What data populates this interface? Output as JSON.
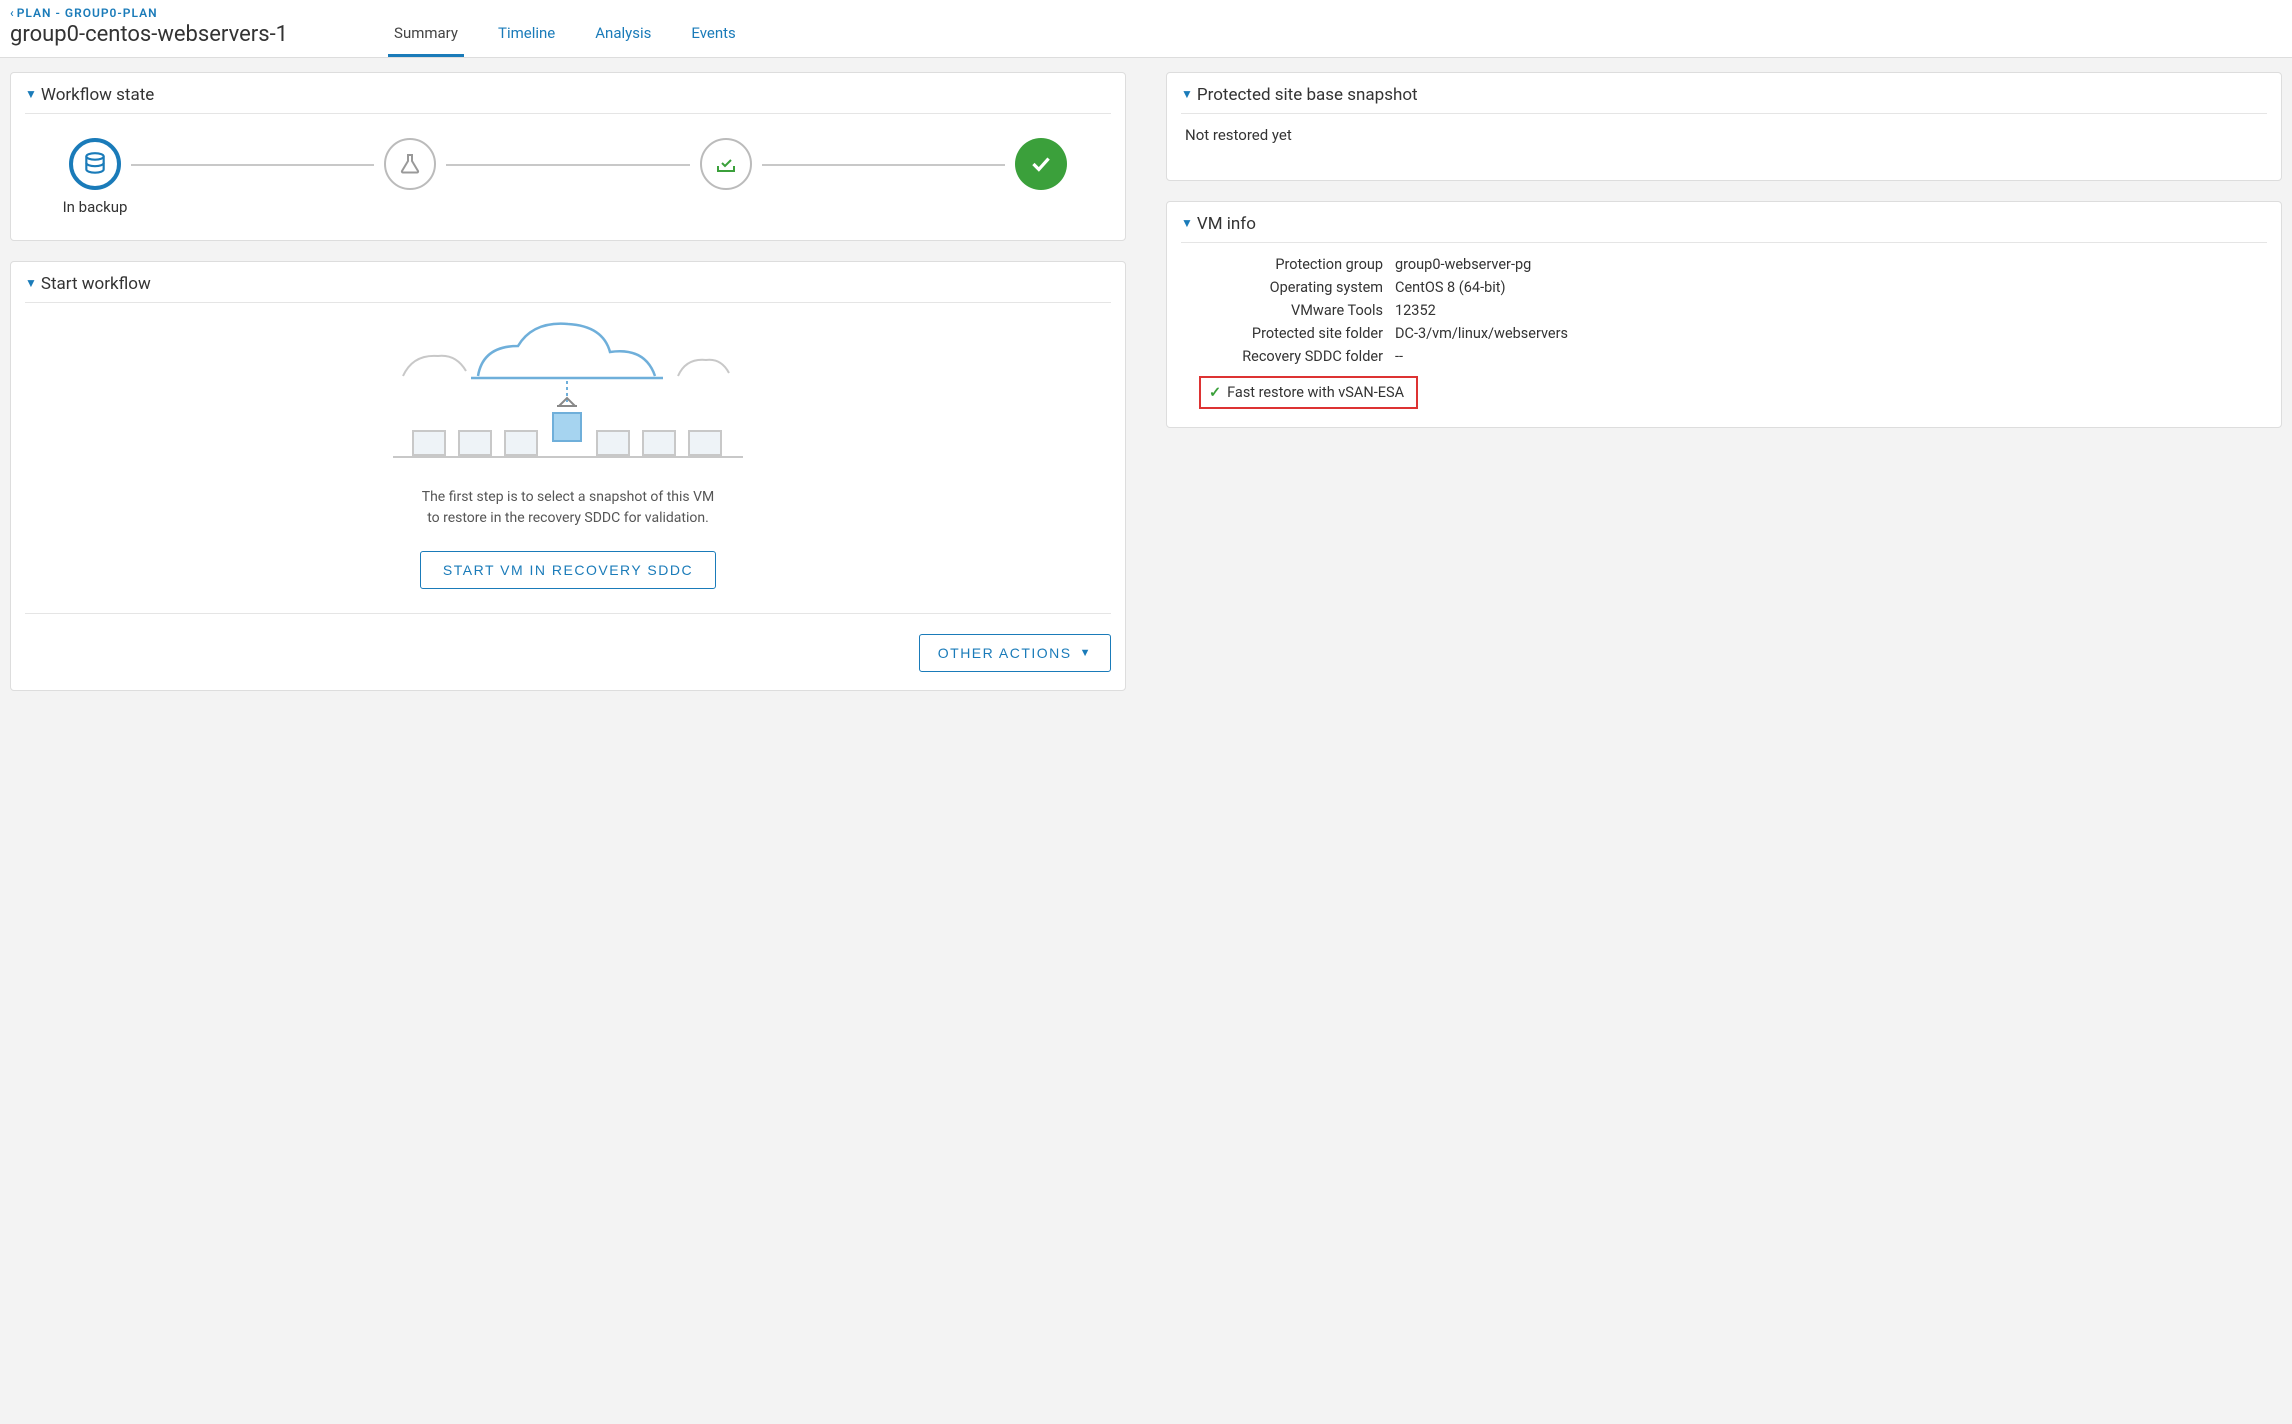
{
  "breadcrumb": {
    "back_label": "PLAN",
    "separator": " - ",
    "plan_name": "GROUP0-PLAN"
  },
  "page_title": "group0-centos-webservers-1",
  "tabs": {
    "summary": "Summary",
    "timeline": "Timeline",
    "analysis": "Analysis",
    "events": "Events"
  },
  "workflow_state": {
    "title": "Workflow state",
    "step1_label": "In backup"
  },
  "start_workflow": {
    "title": "Start workflow",
    "desc_line1": "The first step is to select a snapshot of this VM",
    "desc_line2": "to restore in the recovery SDDC for validation.",
    "start_button": "START VM IN RECOVERY SDDC",
    "other_actions": "OTHER ACTIONS"
  },
  "snapshot": {
    "title": "Protected site base snapshot",
    "status": "Not restored yet"
  },
  "vm_info": {
    "title": "VM info",
    "labels": {
      "protection_group": "Protection group",
      "os": "Operating system",
      "vmware_tools": "VMware Tools",
      "protected_folder": "Protected site folder",
      "recovery_folder": "Recovery SDDC folder"
    },
    "values": {
      "protection_group": "group0-webserver-pg",
      "os": "CentOS 8 (64-bit)",
      "vmware_tools": "12352",
      "protected_folder": "DC-3/vm/linux/webservers",
      "recovery_folder": "--"
    },
    "fast_restore": "Fast restore with vSAN-ESA"
  }
}
